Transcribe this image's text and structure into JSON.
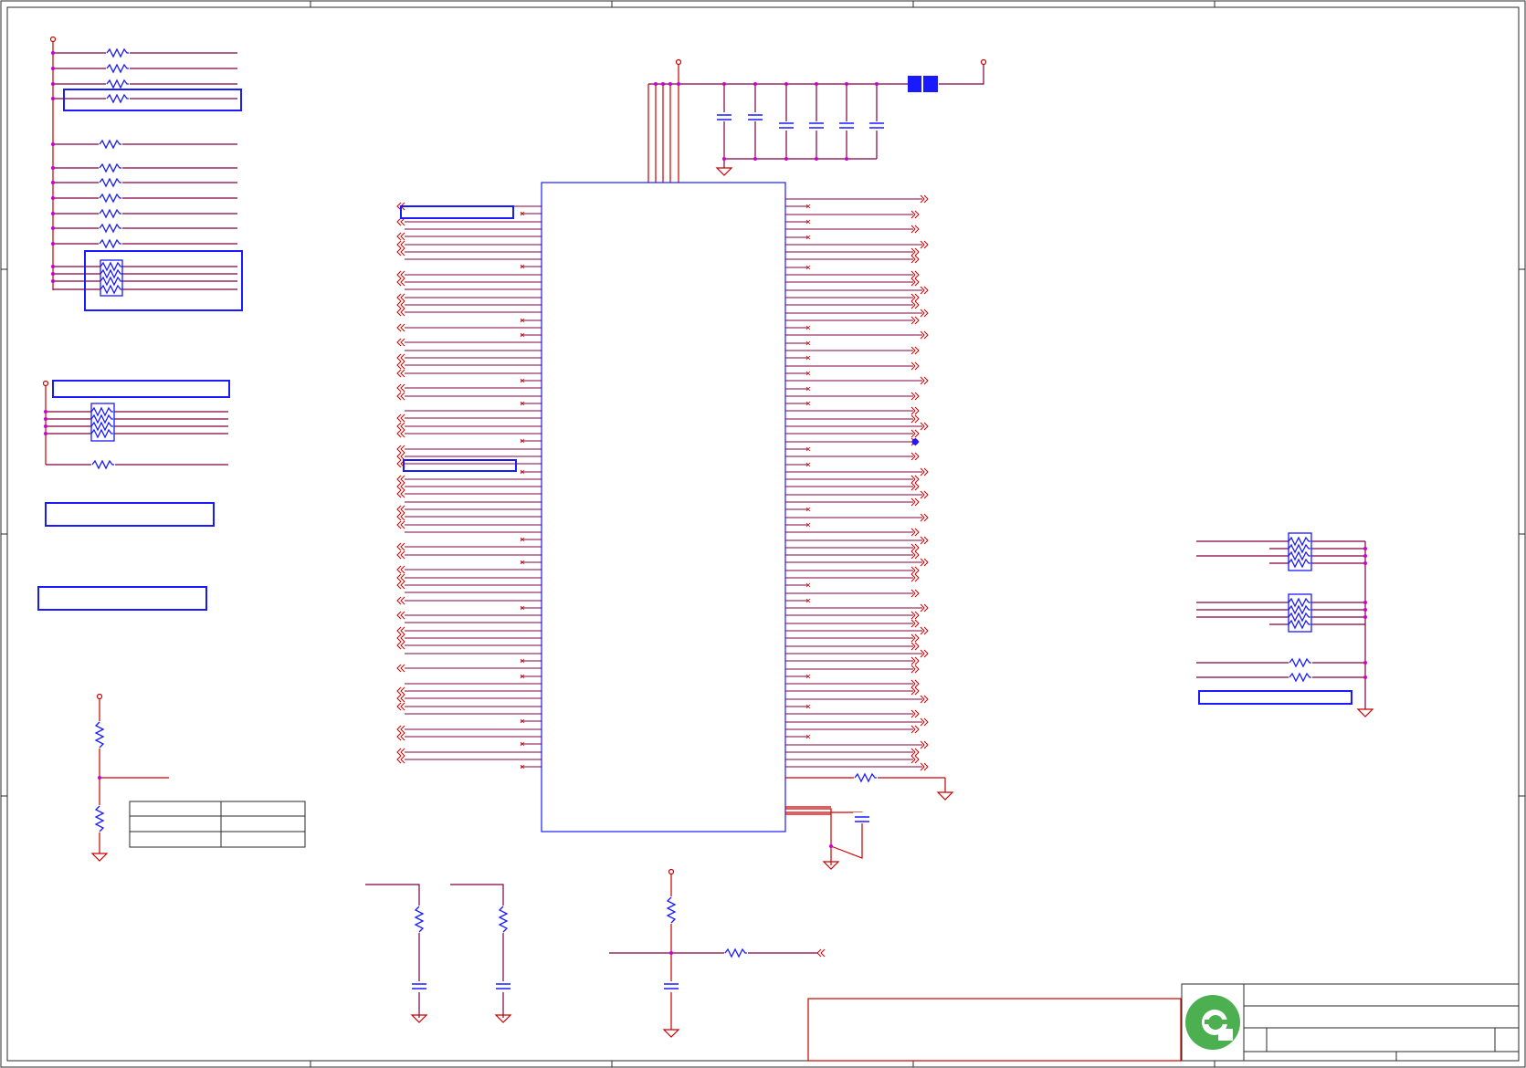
{
  "sheet": {
    "border_color": "#2a2a2a",
    "wire_color": "#cc0000",
    "net_color": "#800040",
    "component_color": "#1a1aff",
    "junction_color": "#cc00cc",
    "logo_color": "#4caf50"
  },
  "icons": {
    "power": "power-port-icon",
    "ground": "ground-icon",
    "resistor": "resistor-icon",
    "capacitor": "capacitor-icon",
    "resistor_network": "resistor-network-icon",
    "bead": "ferrite-bead-icon",
    "off_page": "off-page-connector-icon",
    "no_connect": "no-connect-icon",
    "logo": "company-logo-icon"
  }
}
